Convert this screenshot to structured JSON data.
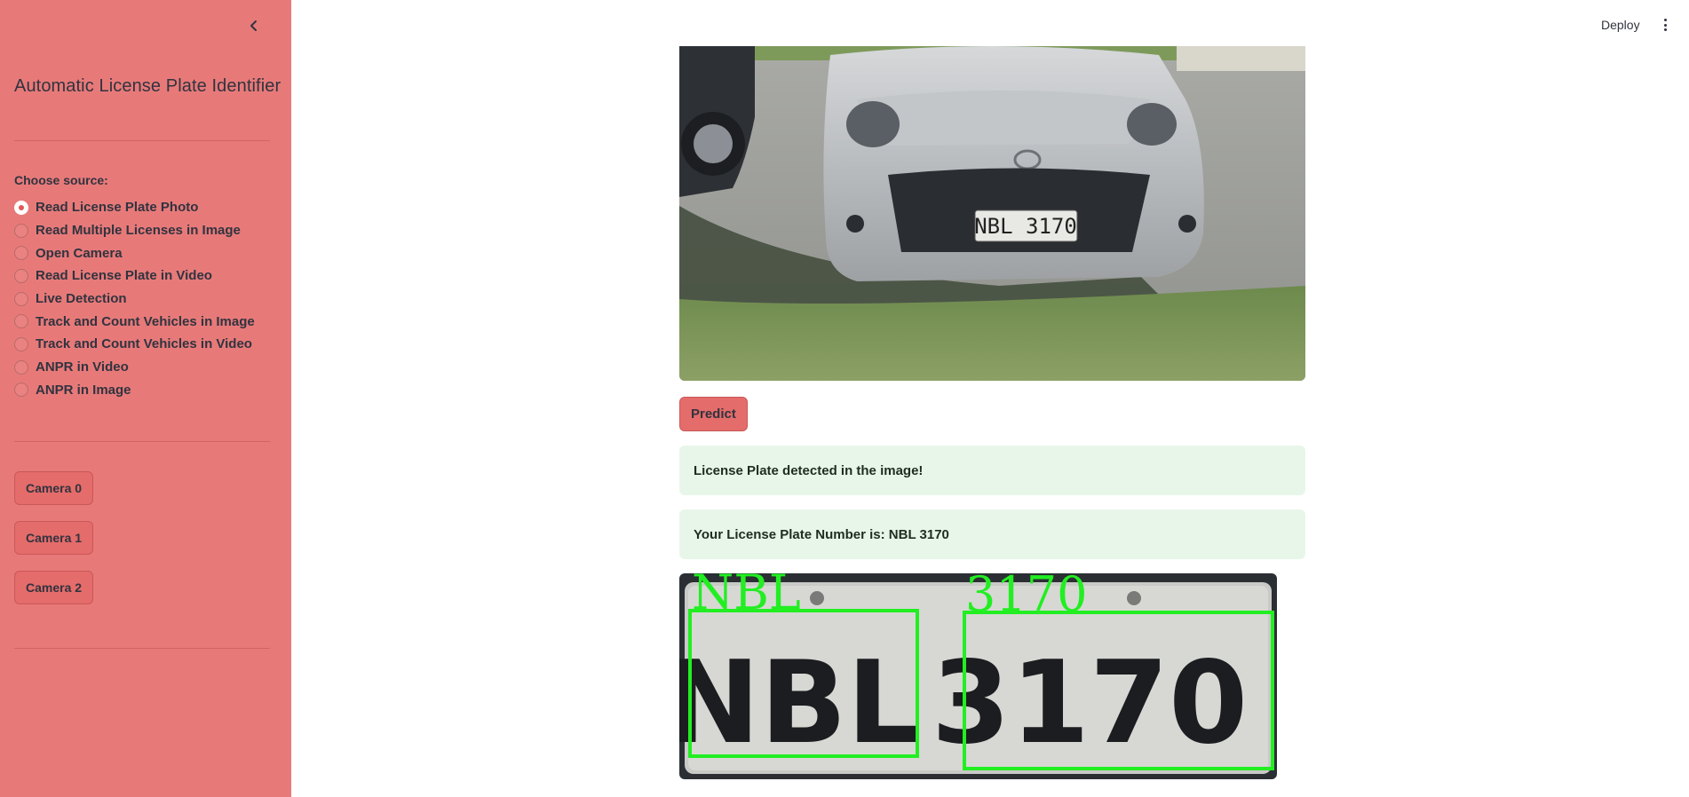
{
  "sidebar": {
    "title": "Automatic License Plate Identifier",
    "source_label": "Choose source:",
    "options": [
      {
        "label": "Read License Plate Photo",
        "selected": true
      },
      {
        "label": "Read Multiple Licenses in Image",
        "selected": false
      },
      {
        "label": "Open Camera",
        "selected": false
      },
      {
        "label": "Read License Plate in Video",
        "selected": false
      },
      {
        "label": "Live Detection",
        "selected": false
      },
      {
        "label": "Track and Count Vehicles in Image",
        "selected": false
      },
      {
        "label": "Track and Count Vehicles in Video",
        "selected": false
      },
      {
        "label": "ANPR in Video",
        "selected": false
      },
      {
        "label": "ANPR in Image",
        "selected": false
      }
    ],
    "camera_buttons": [
      "Camera 0",
      "Camera 1",
      "Camera 2"
    ],
    "background_color": "#e77a79"
  },
  "topbar": {
    "deploy_label": "Deploy"
  },
  "main": {
    "car_plate_text": "NBL 3170",
    "predict_label": "Predict",
    "alerts": [
      "License Plate detected in the image!",
      "Your License Plate Number is: NBL 3170"
    ],
    "plate_crop": {
      "segments": [
        "NBL",
        "3170"
      ],
      "box_color": "#22ee22"
    },
    "accent_color": "#e46c6a",
    "success_bg": "#e8f6ea"
  }
}
